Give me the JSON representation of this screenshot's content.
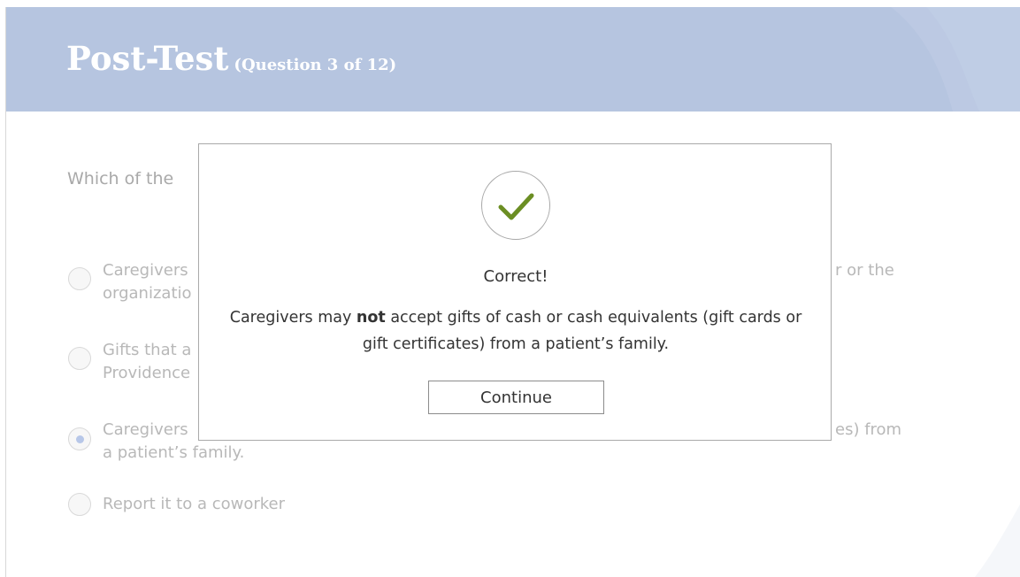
{
  "header": {
    "title": "Post-Test",
    "subtitle": "(Question 3 of 12)"
  },
  "question": {
    "text_visible": "Which of the",
    "options": [
      {
        "lines": [
          "Caregivers",
          "organizatio"
        ],
        "right_fragment": "r or the",
        "selected": false
      },
      {
        "lines": [
          "Gifts that a",
          "Providence"
        ],
        "right_fragment": "",
        "selected": false
      },
      {
        "lines": [
          "Caregivers",
          "a patient’s family."
        ],
        "right_fragment": "es) from",
        "selected": true
      },
      {
        "lines": [
          "Report it to a coworker"
        ],
        "right_fragment": "",
        "selected": false
      }
    ]
  },
  "modal": {
    "icon": "checkmark-icon",
    "status": "Correct!",
    "feedback_before": "Caregivers may ",
    "feedback_bold": "not",
    "feedback_after": " accept gifts of cash or cash equivalents (gift cards or gift certificates) from a patient’s family.",
    "button_label": "Continue"
  },
  "colors": {
    "header_bg": "#b6c5e0",
    "check_green": "#6b8e23",
    "selected_radio": "#b7c7e8"
  }
}
